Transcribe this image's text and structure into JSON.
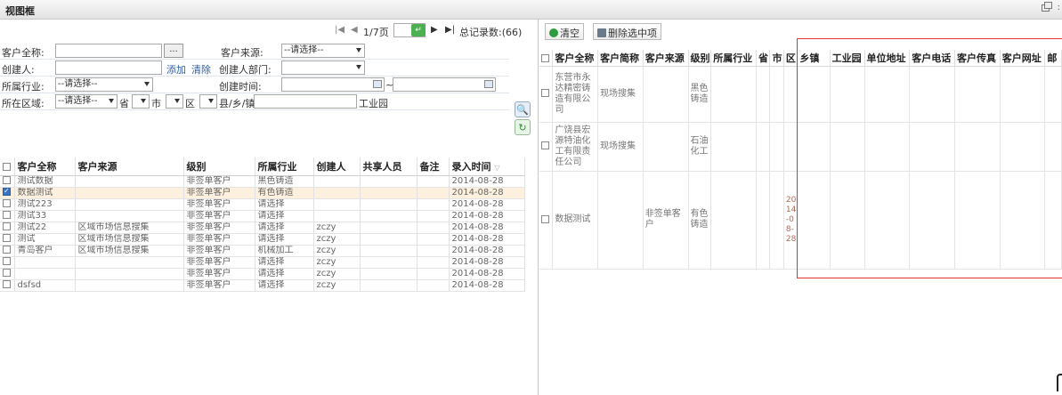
{
  "window": {
    "title": "视图框",
    "more": ":"
  },
  "pager": {
    "page_label": "1/7页",
    "total_label": "总记录数:(66)"
  },
  "form": {
    "customer_name_label": "客户全称:",
    "customer_name_value": "",
    "browse_button": "...",
    "customer_source_label": "客户来源:",
    "customer_source_value": "--请选择--",
    "creator_label": "创建人:",
    "creator_value": "",
    "add_link": "添加",
    "clear_link": "清除",
    "creator_dept_label": "创建人部门:",
    "creator_dept_value": "",
    "industry_label": "所属行业:",
    "industry_value": "--请选择--",
    "created_time_label": "创建时间:",
    "date_separator": "~",
    "region_label": "所在区域:",
    "region_value": "--请选择--",
    "province_label": "省",
    "city_label": "市",
    "district_label": "区",
    "town_label": "县/乡/镇",
    "park_label": "工业园"
  },
  "left_table": {
    "headers": [
      "客户全称",
      "客户来源",
      "级别",
      "所属行业",
      "创建人",
      "共享人员",
      "备注",
      "录入时间"
    ],
    "sort_indicator": "▽",
    "rows": [
      {
        "name": "测试数据",
        "source": "",
        "level": "非签单客户",
        "industry": "黑色铸造",
        "creator": "",
        "share": "",
        "note": "",
        "time": "2014-08-28",
        "checked": false
      },
      {
        "name": "数据测试",
        "source": "",
        "level": "非签单客户",
        "industry": "有色铸造",
        "creator": "",
        "share": "",
        "note": "",
        "time": "2014-08-28",
        "checked": true
      },
      {
        "name": "测试223",
        "source": "",
        "level": "非签单客户",
        "industry": "请选择",
        "creator": "",
        "share": "",
        "note": "",
        "time": "2014-08-28",
        "checked": false
      },
      {
        "name": "测试33",
        "source": "",
        "level": "非签单客户",
        "industry": "请选择",
        "creator": "",
        "share": "",
        "note": "",
        "time": "2014-08-28",
        "checked": false
      },
      {
        "name": "测试22",
        "source": "区域市场信息搜集",
        "level": "非签单客户",
        "industry": "请选择",
        "creator": "zczy",
        "share": "",
        "note": "",
        "time": "2014-08-28",
        "checked": false
      },
      {
        "name": "测试",
        "source": "区域市场信息搜集",
        "level": "非签单客户",
        "industry": "请选择",
        "creator": "zczy",
        "share": "",
        "note": "",
        "time": "2014-08-28",
        "checked": false
      },
      {
        "name": "青岛客户",
        "source": "区域市场信息搜集",
        "level": "非签单客户",
        "industry": "机械加工",
        "creator": "zczy",
        "share": "",
        "note": "",
        "time": "2014-08-28",
        "checked": false
      },
      {
        "name": "",
        "source": "",
        "level": "非签单客户",
        "industry": "请选择",
        "creator": "zczy",
        "share": "",
        "note": "",
        "time": "2014-08-28",
        "checked": false
      },
      {
        "name": "",
        "source": "",
        "level": "非签单客户",
        "industry": "请选择",
        "creator": "zczy",
        "share": "",
        "note": "",
        "time": "2014-08-28",
        "checked": false
      },
      {
        "name": "dsfsd",
        "source": "",
        "level": "非签单客户",
        "industry": "请选择",
        "creator": "zczy",
        "share": "",
        "note": "",
        "time": "2014-08-28",
        "checked": false
      }
    ]
  },
  "right_toolbar": {
    "clear_label": "清空",
    "delete_label": "删除选中项"
  },
  "right_table": {
    "headers": [
      "客户全称",
      "客户简称",
      "客户来源",
      "级别",
      "所属行业",
      "省",
      "市",
      "区",
      "乡镇",
      "工业园",
      "单位地址",
      "客户电话",
      "客户传真",
      "客户网址",
      "邮"
    ],
    "rows": [
      {
        "name": "东营市永达精密铸造有限公司",
        "short": "现场搜集",
        "source": "",
        "level": "黑色铸造",
        "industry": "",
        "district": ""
      },
      {
        "name": "广饶县宏源特油化工有限责任公司",
        "short": "现场搜集",
        "source": "",
        "level": "石油化工",
        "industry": "",
        "district": ""
      },
      {
        "name": "数据测试",
        "short": "",
        "source": "非签单客户",
        "level": "有色铸造",
        "industry": "",
        "district": "2014-08-28"
      }
    ]
  },
  "colors": {
    "accent": "#2a5ea8",
    "selected_row": "#fdf0de",
    "highlight_box": "#dd3333"
  }
}
